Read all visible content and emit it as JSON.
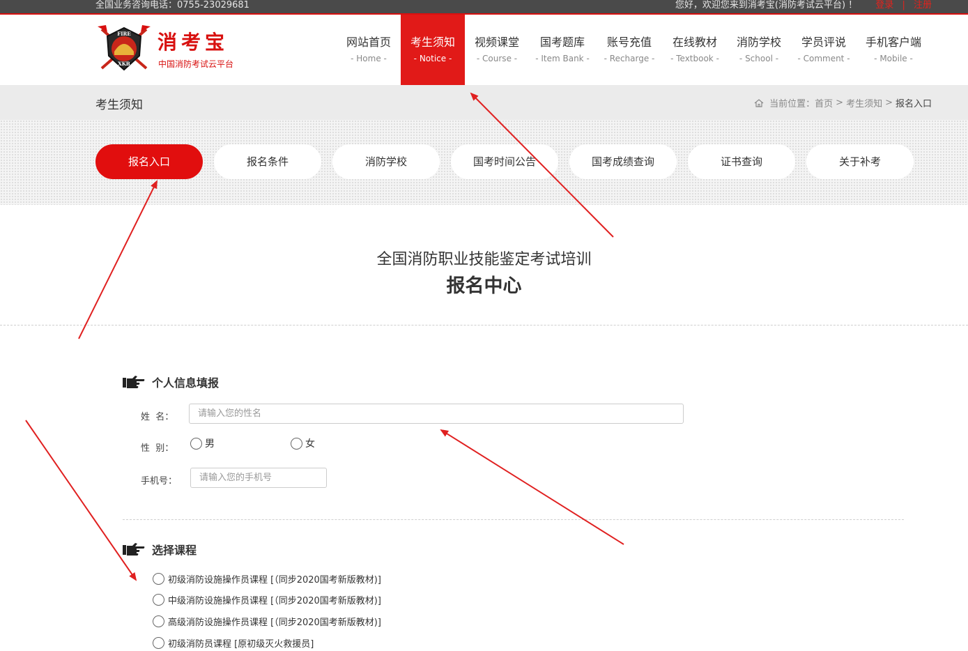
{
  "topbar": {
    "phone": "全国业务咨询电话：0755-23029681",
    "welcome": "您好，欢迎您来到消考宝(消防考试云平台) ！",
    "login": "登录",
    "separator": "|",
    "register": "注册"
  },
  "brand": {
    "name": "消考宝",
    "subtitle": "中国消防考试云平台",
    "logo_top": "FIRE",
    "logo_bottom": "XKB"
  },
  "nav": [
    {
      "zh": "网站首页",
      "en": "- Home -"
    },
    {
      "zh": "考生须知",
      "en": "- Notice -"
    },
    {
      "zh": "视频课堂",
      "en": "- Course -"
    },
    {
      "zh": "国考题库",
      "en": "- Item Bank -"
    },
    {
      "zh": "账号充值",
      "en": "- Recharge -"
    },
    {
      "zh": "在线教材",
      "en": "- Textbook -"
    },
    {
      "zh": "消防学校",
      "en": "- School -"
    },
    {
      "zh": "学员评说",
      "en": "- Comment -"
    },
    {
      "zh": "手机客户端",
      "en": "- Mobile -"
    }
  ],
  "active_nav": "考生须知",
  "band": {
    "title": "考生须知",
    "crumb_prefix": "当前位置：",
    "crumb": [
      "首页",
      "考生须知",
      "报名入口"
    ],
    "crumb_sep": ">"
  },
  "tabs": [
    "报名入口",
    "报名条件",
    "消防学校",
    "国考时间公告",
    "国考成绩查询",
    "证书查询",
    "关于补考"
  ],
  "active_tab": "报名入口",
  "main": {
    "title_line1": "全国消防职业技能鉴定考试培训",
    "title_line2": "报名中心"
  },
  "form": {
    "section1": "个人信息填报",
    "name_label": "姓  名：",
    "name_placeholder": "请输入您的性名",
    "gender_label": "性  别：",
    "gender_male": "男",
    "gender_female": "女",
    "phone_label": "手机号：",
    "phone_placeholder": "请输入您的手机号",
    "section2": "选择课程",
    "courses": [
      "初级消防设施操作员课程 [（同步2020国考新版教材)]",
      "中级消防设施操作员课程 [（同步2020国考新版教材)]",
      "高级消防设施操作员课程 [（同步2020国考新版教材)]",
      "初级消防员课程 [原初级灭火救援员]"
    ]
  },
  "colors": {
    "brand_red": "#e11a18",
    "topbar": "#4a4a4a",
    "band": "#ebebeb",
    "annotation_arrow": "#e02020"
  }
}
